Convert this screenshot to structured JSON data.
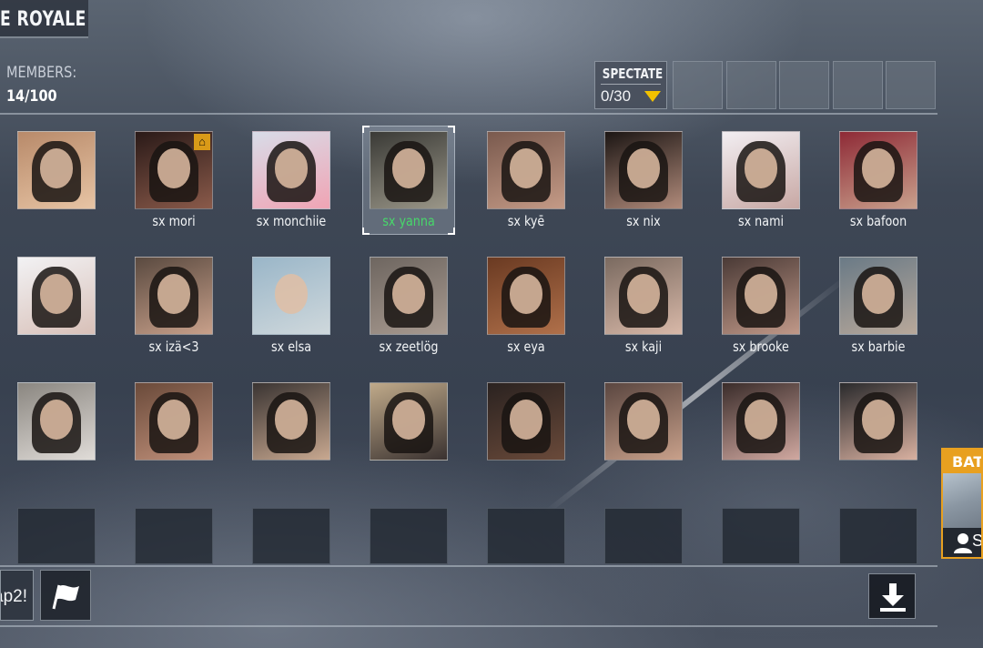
{
  "header": {
    "title": "E ROYALE"
  },
  "members": {
    "label": "MEMBERS:",
    "count": "14/100"
  },
  "spectate": {
    "label": "SPECTATE",
    "count": "0/30"
  },
  "players": [
    {
      "name": "",
      "colors": [
        "#b88a6a",
        "#e7c4a4"
      ],
      "hair": true
    },
    {
      "name": "sx mori",
      "colors": [
        "#2a1a18",
        "#8a5a4a"
      ],
      "hair": true,
      "home": true
    },
    {
      "name": "sx monchiie",
      "colors": [
        "#d8dce8",
        "#f0a4b4"
      ],
      "hair": true
    },
    {
      "name": "sx yanna",
      "colors": [
        "#3a3a36",
        "#9a9688"
      ],
      "hair": true,
      "selected": true
    },
    {
      "name": "sx kyē",
      "colors": [
        "#7a5a4e",
        "#c49a86"
      ],
      "hair": true
    },
    {
      "name": "sx nix",
      "colors": [
        "#1c1614",
        "#b08a7a"
      ],
      "hair": true
    },
    {
      "name": "sx nami",
      "colors": [
        "#f2eef2",
        "#c8a8a4"
      ],
      "hair": true
    },
    {
      "name": "sx bafoon",
      "colors": [
        "#8e2a36",
        "#c9a08c"
      ],
      "hair": true
    },
    {
      "name": "",
      "colors": [
        "#f2f2f4",
        "#d8c0b8"
      ],
      "hair": true
    },
    {
      "name": "sx izä<3",
      "colors": [
        "#5a4a40",
        "#c8a08a"
      ],
      "hair": true
    },
    {
      "name": "sx elsa",
      "colors": [
        "#9ab6c8",
        "#cfd8dc"
      ],
      "hair": false
    },
    {
      "name": "sx zeetlög",
      "colors": [
        "#6e6660",
        "#a89a90"
      ],
      "hair": true
    },
    {
      "name": "sx eya",
      "colors": [
        "#6a3a22",
        "#b0704a"
      ],
      "hair": true
    },
    {
      "name": "sx kaji",
      "colors": [
        "#7a6a60",
        "#d8b8a8"
      ],
      "hair": true
    },
    {
      "name": "sx brooke",
      "colors": [
        "#4a3a36",
        "#c09888"
      ],
      "hair": true
    },
    {
      "name": "sx barbie",
      "colors": [
        "#6a7a86",
        "#b8a89a"
      ],
      "hair": true
    },
    {
      "name": "",
      "colors": [
        "#8a8680",
        "#e0dcd8"
      ],
      "hair": true
    },
    {
      "name": "",
      "colors": [
        "#6a4a3a",
        "#c0907a"
      ],
      "hair": true
    },
    {
      "name": "",
      "colors": [
        "#3a3432",
        "#c8a890"
      ],
      "hair": true
    },
    {
      "name": "",
      "colors": [
        "#c0aa8a",
        "#3a3230"
      ],
      "hair": true
    },
    {
      "name": "",
      "colors": [
        "#2a2220",
        "#6a4a3a"
      ],
      "hair": true
    },
    {
      "name": "",
      "colors": [
        "#5a4640",
        "#c8a08a"
      ],
      "hair": true
    },
    {
      "name": "",
      "colors": [
        "#3a2c2a",
        "#d0a8a0"
      ],
      "hair": true
    },
    {
      "name": "",
      "colors": [
        "#2a2a2c",
        "#d8b0a0"
      ],
      "hair": true
    }
  ],
  "chat": {
    "input_value": "ap2!"
  },
  "battle": {
    "label": "BATT",
    "sub": "S"
  },
  "colors": {
    "accent": "#f2c200",
    "selected_name": "#47d86a",
    "battle_orange": "#e8a020"
  },
  "icons": {
    "flag": "flag-icon",
    "download": "download-icon",
    "home": "home-icon",
    "person": "person-icon"
  }
}
